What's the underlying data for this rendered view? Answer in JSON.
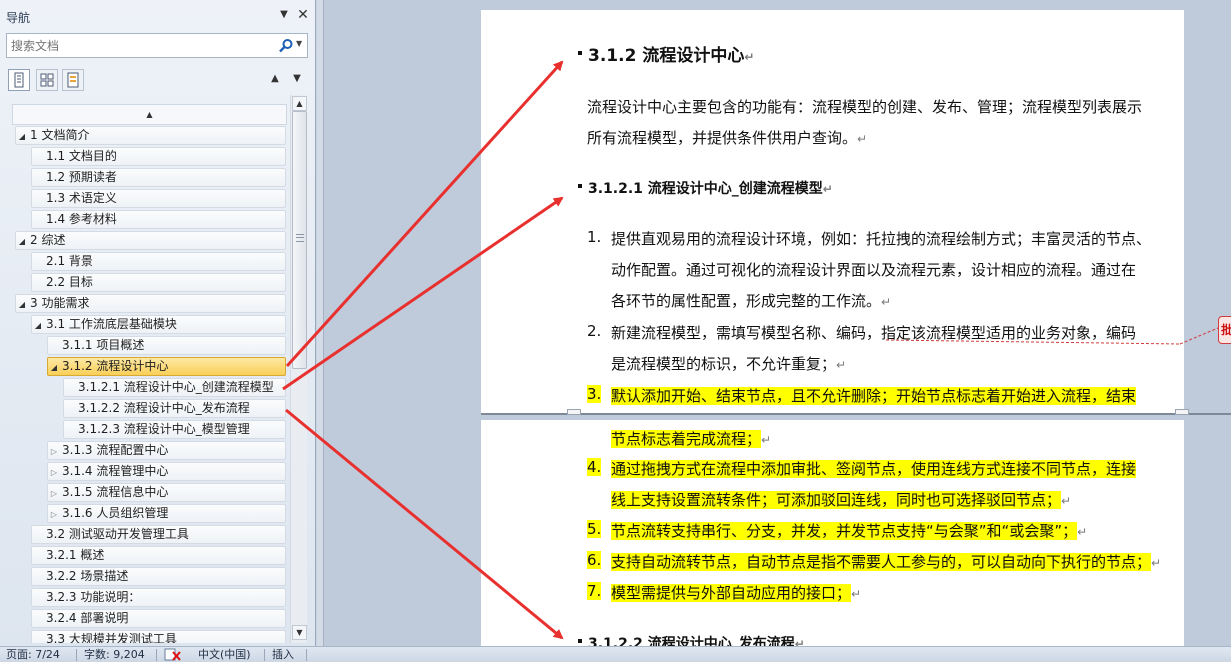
{
  "nav": {
    "title": "导航",
    "search_placeholder": "搜索文档",
    "tree": [
      {
        "label": "1 文档简介",
        "level": 0,
        "toggle": "expanded"
      },
      {
        "label": "1.1 文档目的",
        "level": 1
      },
      {
        "label": "1.2 预期读者",
        "level": 1
      },
      {
        "label": "1.3 术语定义",
        "level": 1
      },
      {
        "label": "1.4 参考材料",
        "level": 1
      },
      {
        "label": "2 综述",
        "level": 0,
        "toggle": "expanded"
      },
      {
        "label": "2.1 背景",
        "level": 1
      },
      {
        "label": "2.2 目标",
        "level": 1
      },
      {
        "label": "3 功能需求",
        "level": 0,
        "toggle": "expanded"
      },
      {
        "label": "3.1 工作流底层基础模块",
        "level": 1,
        "toggle": "expanded"
      },
      {
        "label": "3.1.1 项目概述",
        "level": 2
      },
      {
        "label": "3.1.2 流程设计中心",
        "level": 2,
        "toggle": "expanded",
        "selected": true
      },
      {
        "label": "3.1.2.1 流程设计中心_创建流程模型",
        "level": 3
      },
      {
        "label": "3.1.2.2 流程设计中心_发布流程",
        "level": 3
      },
      {
        "label": "3.1.2.3 流程设计中心_模型管理",
        "level": 3
      },
      {
        "label": "3.1.3 流程配置中心",
        "level": 2,
        "toggle": "collapsed"
      },
      {
        "label": "3.1.4 流程管理中心",
        "level": 2,
        "toggle": "collapsed"
      },
      {
        "label": "3.1.5 流程信息中心",
        "level": 2,
        "toggle": "collapsed"
      },
      {
        "label": "3.1.6 人员组织管理",
        "level": 2,
        "toggle": "collapsed"
      },
      {
        "label": "3.2 测试驱动开发管理工具",
        "level": 1
      },
      {
        "label": "3.2.1 概述",
        "level": 1
      },
      {
        "label": "3.2.2 场景描述",
        "level": 1
      },
      {
        "label": "3.2.3 功能说明：",
        "level": 1
      },
      {
        "label": "3.2.4 部署说明",
        "level": 1
      },
      {
        "label": "3.3 大规模并发测试工具",
        "level": 1
      }
    ]
  },
  "doc": {
    "h_312": "3.1.2 流程设计中心",
    "intro_1": "流程设计中心主要包含的功能有：流程模型的创建、发布、管理；流程模型列表展示",
    "intro_2": "所有流程模型，并提供条件供用户查询。",
    "h_3121": "3.1.2.1  流程设计中心_创建流程模型",
    "items": [
      {
        "num": "1.",
        "lines": [
          "提供直观易用的流程设计环境，例如：托拉拽的流程绘制方式；丰富灵活的节点、",
          "动作配置。通过可视化的流程设计界面以及流程元素，设计相应的流程。通过在",
          "各环节的属性配置，形成完整的工作流。"
        ]
      },
      {
        "num": "2.",
        "lines": [
          "新建流程模型，需填写模型名称、编码，指定该流程模型适用的业务对象，编码",
          "是流程模型的标识，不允许重复；"
        ]
      },
      {
        "num": "3.",
        "lines": [
          "默认添加开始、结束节点，且不允许删除；开始节点标志着开始进入流程，结束",
          "节点标志着完成流程；"
        ],
        "highlight": true
      },
      {
        "num": "4.",
        "lines": [
          "通过拖拽方式在流程中添加审批、签阅节点，使用连线方式连接不同节点，连接",
          "线上支持设置流转条件；可添加驳回连线，同时也可选择驳回节点；"
        ],
        "highlight": true
      },
      {
        "num": "5.",
        "lines": [
          "节点流转支持串行、分支，并发，并发节点支持“与会聚”和“或会聚”；"
        ],
        "highlight": true
      },
      {
        "num": "6.",
        "lines": [
          "支持自动流转节点，自动节点是指不需要人工参与的，可以自动向下执行的节点；"
        ],
        "highlight": true
      },
      {
        "num": "7.",
        "lines": [
          "模型需提供与外部自动应用的接口；"
        ],
        "highlight": true
      }
    ],
    "h_3122": "3.1.2.2  流程设计中心_发布流程",
    "pilcrow": "↵",
    "comment_mark": "批"
  },
  "status": {
    "page": "页面: 7/24",
    "words": "字数: 9,204",
    "language": "中文(中国)",
    "mode": "插入"
  },
  "colors": {
    "highlight": "#ffff00",
    "selection": "#f9cf58",
    "arrow": "#e8302e"
  }
}
